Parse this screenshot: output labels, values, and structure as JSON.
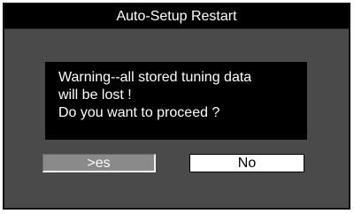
{
  "dialog": {
    "title": "Auto-Setup Restart",
    "message_lines": [
      "Warning--all stored tuning data",
      "will be lost !",
      "Do you want to proceed ?"
    ]
  },
  "buttons": {
    "yes_label": ">es",
    "no_label": "No"
  },
  "colors": {
    "panel_bg": "#4a4a4a",
    "title_bg": "#000000",
    "message_bg": "#000000",
    "yes_bg": "#8a8a8a",
    "no_bg": "#ffffff"
  }
}
